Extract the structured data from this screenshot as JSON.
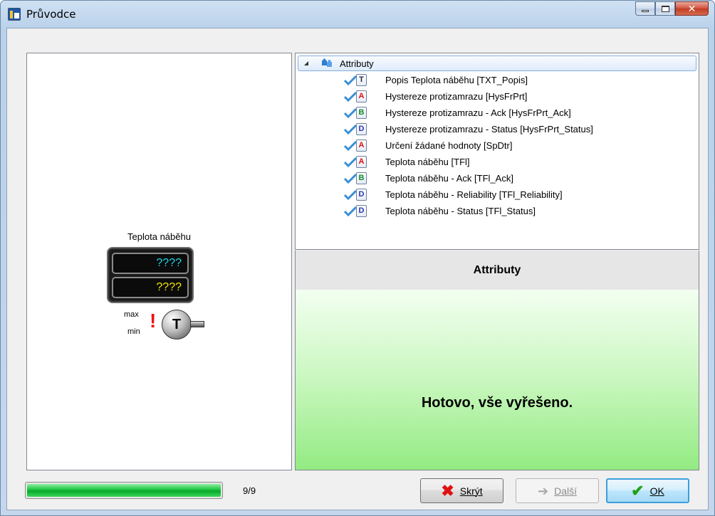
{
  "window": {
    "title": "Průvodce"
  },
  "widget": {
    "label": "Teplota náběhu",
    "value_top": "????",
    "value_bottom": "????",
    "max_label": "max",
    "min_label": "min",
    "alarm_glyph": "!",
    "sensor_letter": "T"
  },
  "tree": {
    "root_label": "Attributy",
    "items": [
      {
        "type": "T",
        "label": "Popis Teplota náběhu [TXT_Popis]"
      },
      {
        "type": "A",
        "label": "Hystereze protizamrazu [HysFrPrt]"
      },
      {
        "type": "B",
        "label": "Hystereze protizamrazu - Ack [HysFrPrt_Ack]"
      },
      {
        "type": "D",
        "label": "Hystereze protizamrazu - Status [HysFrPrt_Status]"
      },
      {
        "type": "A",
        "label": "Určení žádané hodnoty [SpDtr]"
      },
      {
        "type": "A",
        "label": "Teplota náběhu [TFl]"
      },
      {
        "type": "B",
        "label": "Teplota náběhu - Ack [TFl_Ack]"
      },
      {
        "type": "D",
        "label": "Teplota náběhu - Reliability [TFl_Reliability]"
      },
      {
        "type": "D",
        "label": "Teplota náběhu - Status [TFl_Status]"
      }
    ]
  },
  "description": {
    "header": "Attributy",
    "message": "Hotovo, vše vyřešeno."
  },
  "progress": {
    "value": 9,
    "max": 9,
    "text": "9/9"
  },
  "buttons": {
    "hide_label": "Skrýt",
    "next_label": "Další",
    "ok_label": "OK"
  },
  "colors": {
    "accent": "#3c9fdc",
    "progress": "#07a82b",
    "check": "#3b8fd6"
  },
  "icons": {
    "app": "app-logo-icon",
    "expander": "collapse-triangle-icon",
    "root": "puzzle-icon",
    "check": "checkmark-icon",
    "hide": "red-x-icon",
    "next": "arrow-right-icon",
    "ok": "green-check-icon"
  }
}
